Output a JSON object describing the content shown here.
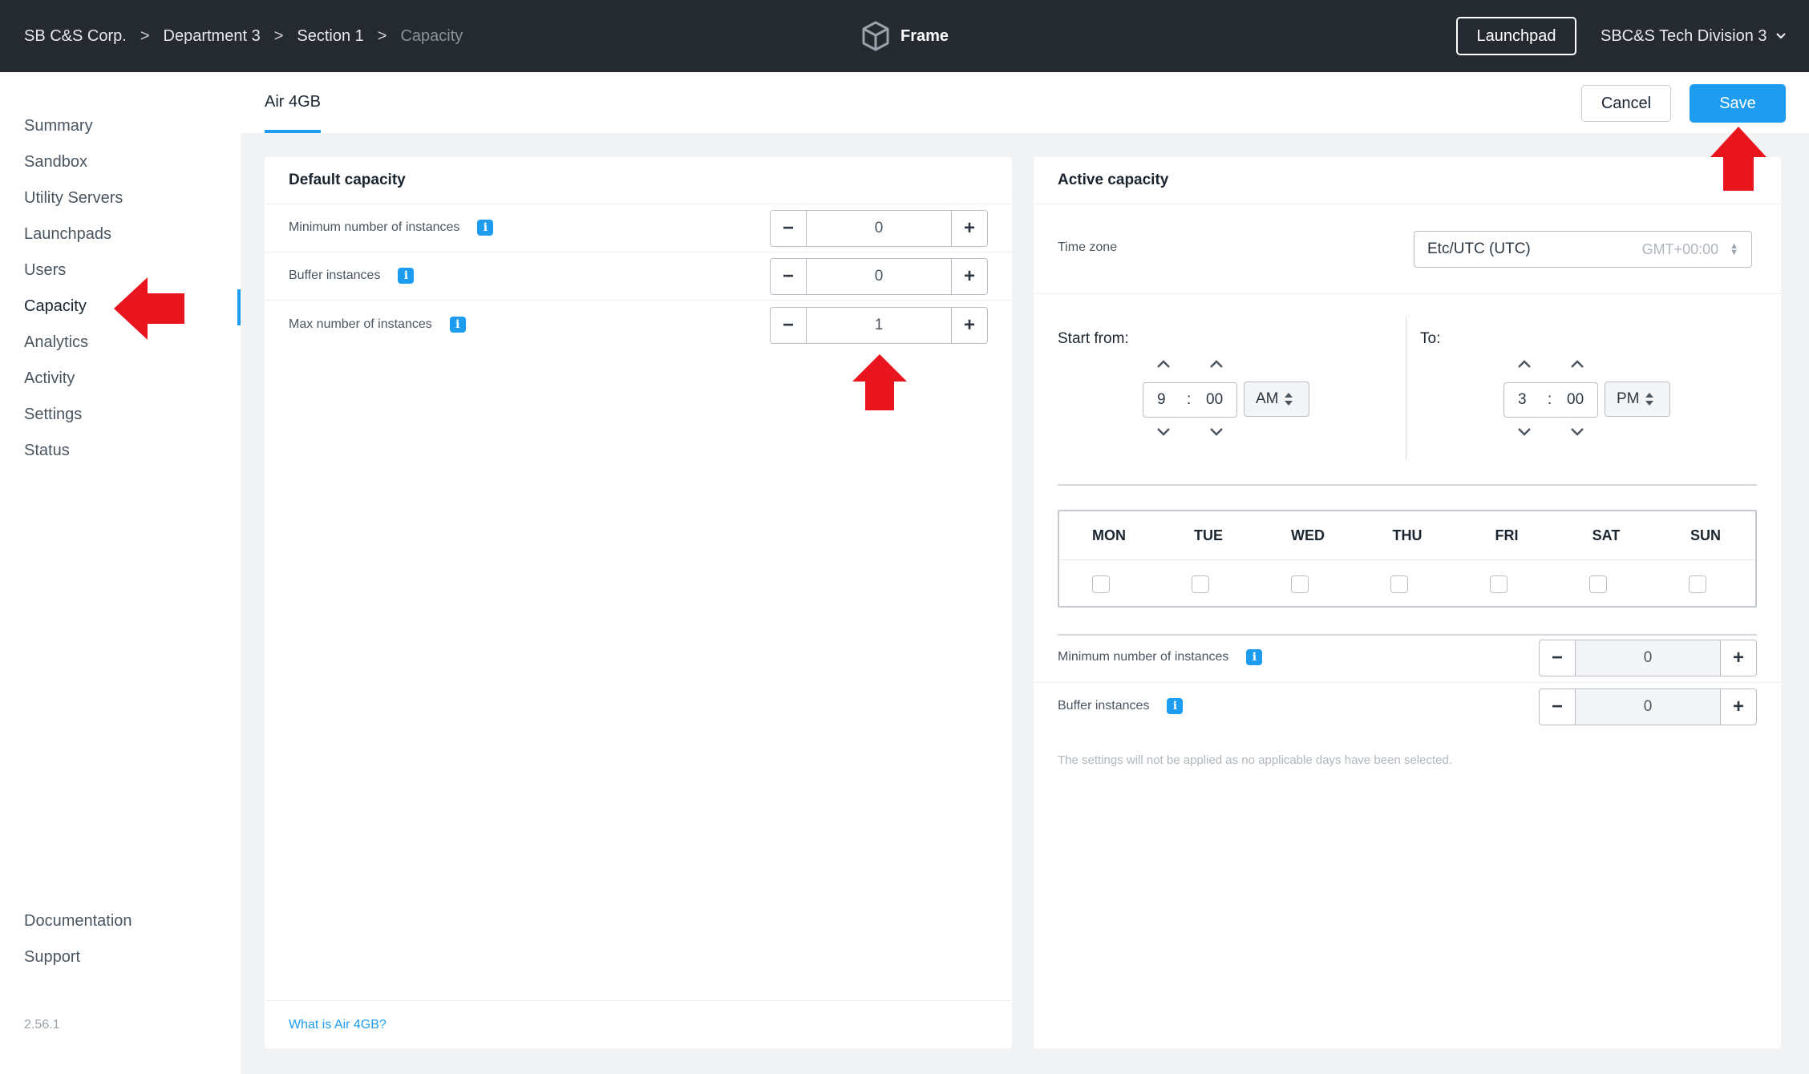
{
  "breadcrumb": [
    "SB C&S Corp.",
    "Department 3",
    "Section 1",
    "Capacity"
  ],
  "breadcrumb_separator": ">",
  "brand": {
    "name": "Frame"
  },
  "header": {
    "launchpad_label": "Launchpad",
    "account_label": "SBC&S Tech Division 3"
  },
  "sidebar": {
    "items": [
      "Summary",
      "Sandbox",
      "Utility Servers",
      "Launchpads",
      "Users",
      "Capacity",
      "Analytics",
      "Activity",
      "Settings",
      "Status"
    ],
    "active": "Capacity",
    "footer_items": [
      "Documentation",
      "Support"
    ],
    "version": "2.56.1"
  },
  "tab": {
    "label": "Air 4GB"
  },
  "actions": {
    "cancel": "Cancel",
    "save": "Save"
  },
  "default_capacity": {
    "title": "Default capacity",
    "rows": [
      {
        "label": "Minimum number of instances",
        "value": "0"
      },
      {
        "label": "Buffer instances",
        "value": "0"
      },
      {
        "label": "Max number of instances",
        "value": "1"
      }
    ],
    "help_link": "What is Air 4GB?"
  },
  "active_capacity": {
    "title": "Active capacity",
    "timezone_label": "Time zone",
    "timezone_value": "Etc/UTC (UTC)",
    "timezone_offset": "GMT+00:00",
    "start_label": "Start from:",
    "start": {
      "hour": "9",
      "minute": "00",
      "ampm": "AM"
    },
    "end_label": "To:",
    "end": {
      "hour": "3",
      "minute": "00",
      "ampm": "PM"
    },
    "time_colon": ":",
    "days": [
      "MON",
      "TUE",
      "WED",
      "THU",
      "FRI",
      "SAT",
      "SUN"
    ],
    "rows": [
      {
        "label": "Minimum number of instances",
        "value": "0"
      },
      {
        "label": "Buffer instances",
        "value": "0"
      }
    ],
    "note": "The settings will not be applied as no applicable days have been selected."
  },
  "icons": {
    "info": "i",
    "minus": "−",
    "plus": "+",
    "chevron_up": "⌃",
    "chevron_down": "⌄",
    "caret_down": "⌄"
  },
  "colors": {
    "topbar": "#252a31",
    "accent": "#1e9cf0",
    "annotation_arrow": "#e8141e"
  }
}
